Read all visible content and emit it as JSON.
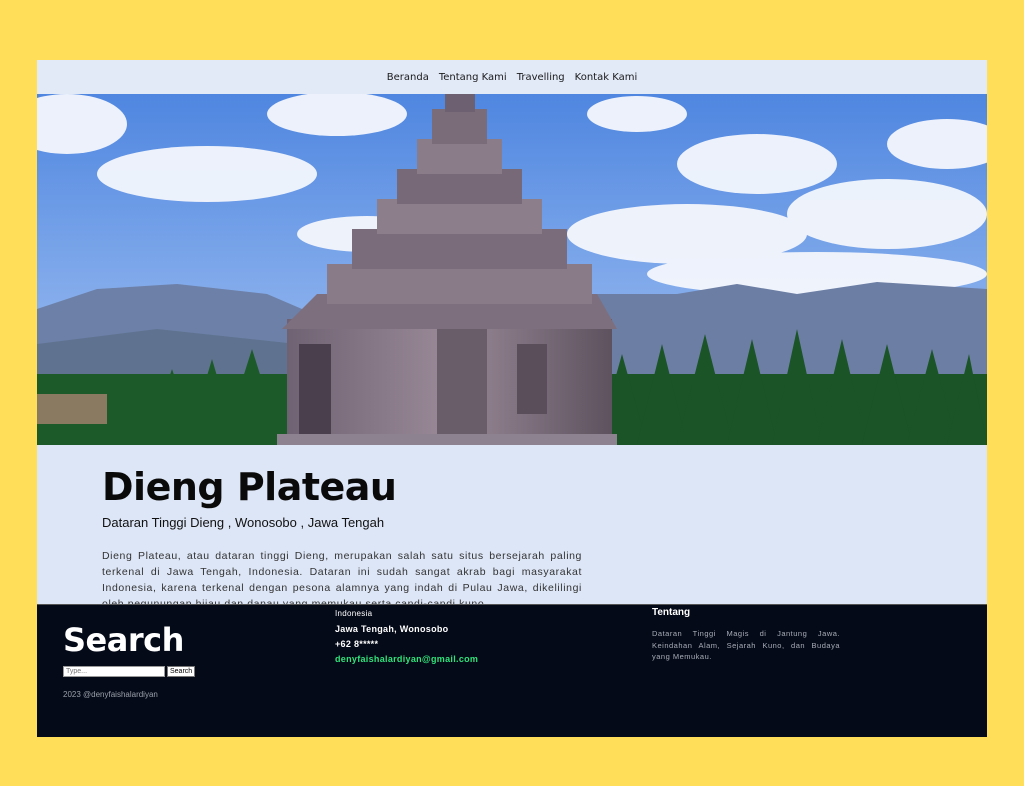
{
  "nav": {
    "items": [
      {
        "label": "Beranda"
      },
      {
        "label": "Tentang Kami"
      },
      {
        "label": "Travelling"
      },
      {
        "label": "Kontak Kami"
      }
    ]
  },
  "hero": {
    "image": "dieng-temple-photo"
  },
  "article": {
    "title": "Dieng Plateau",
    "subtitle": "Dataran Tinggi Dieng , Wonosobo , Jawa Tengah",
    "body": "Dieng Plateau, atau dataran tinggi Dieng, merupakan salah satu situs bersejarah paling terkenal di Jawa Tengah, Indonesia. Dataran ini sudah sangat akrab bagi masyarakat Indonesia, karena terkenal dengan pesona alamnya yang indah di Pulau Jawa, dikelilingi oleh pegunungan hijau dan danau yang memukau serta candi-candi kuno."
  },
  "footer": {
    "search_title": "Search",
    "search_placeholder": "Type...",
    "search_button": "Search",
    "copyright": "2023 @denyfaishalardiyan",
    "contact": {
      "country": "Indonesia",
      "region": "Jawa Tengah, Wonosobo",
      "phone": "+62 8*****",
      "email": "denyfaishalardiyan@gmail.com"
    },
    "about": {
      "title": "Tentang",
      "text": "Dataran Tinggi Magis di Jantung Jawa. Keindahan Alam, Sejarah Kuno, dan Budaya yang Memukau."
    }
  },
  "colors": {
    "background": "#FFDE59",
    "page": "#dde6f6",
    "footer": "#050a18",
    "email": "#2fe37a"
  }
}
